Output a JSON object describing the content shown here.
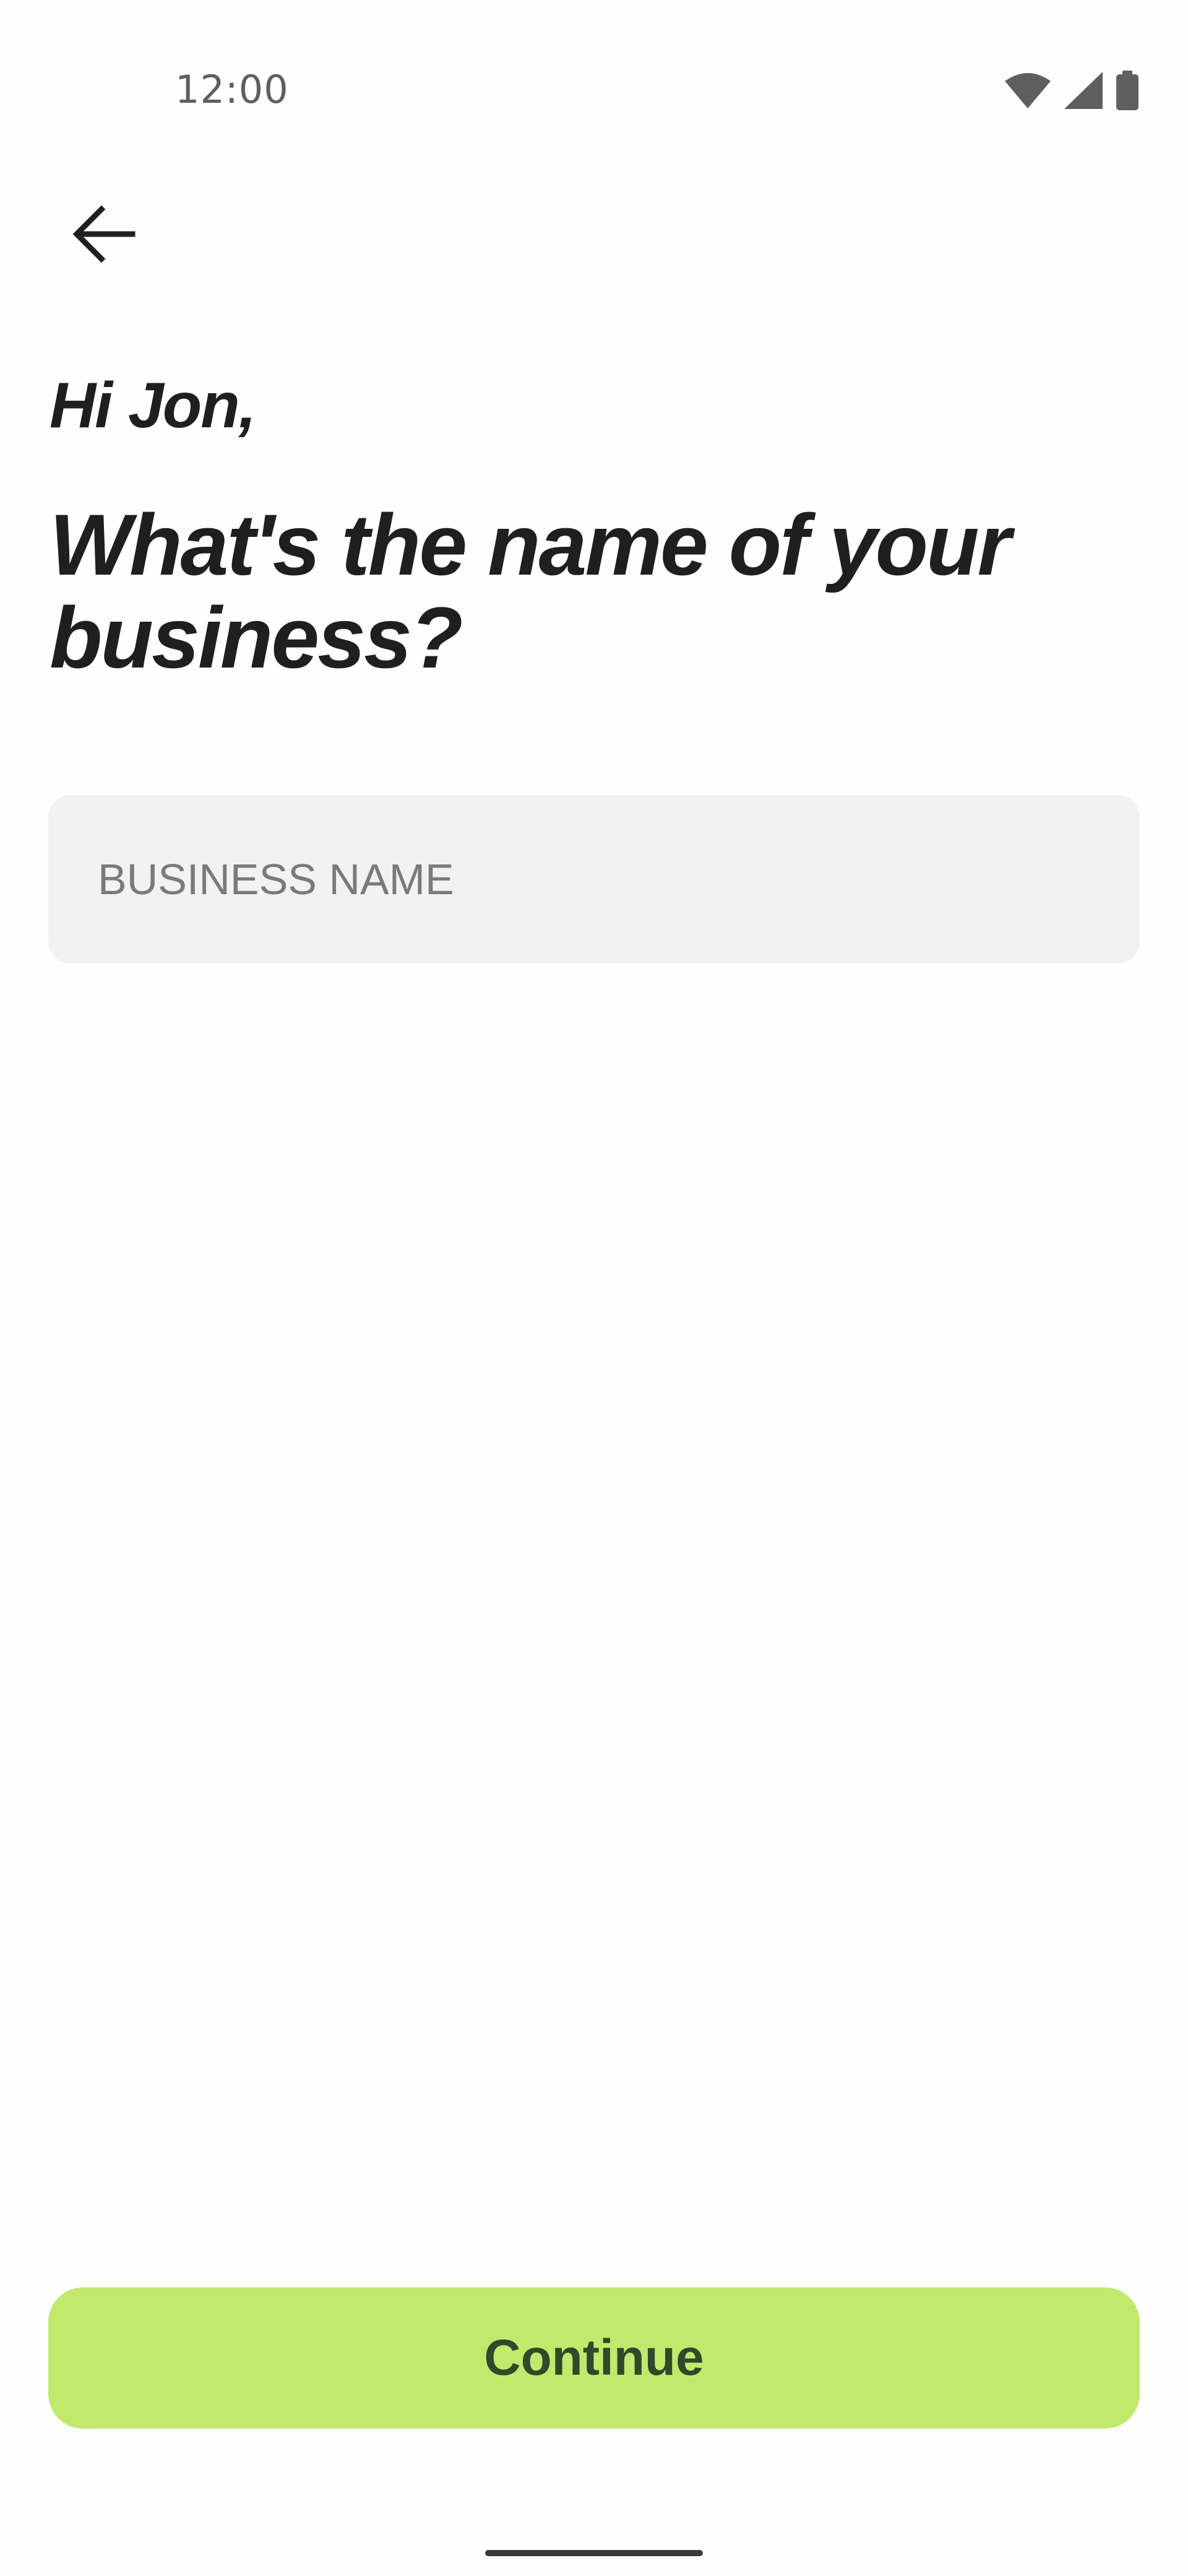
{
  "status_bar": {
    "time": "12:00",
    "icons": [
      "wifi-icon",
      "cellular-signal-icon",
      "battery-icon"
    ]
  },
  "header": {
    "back_icon": "arrow-left-icon"
  },
  "main": {
    "greeting": "Hi Jon,",
    "question": "What's the name of your business?",
    "business_name": {
      "value": "",
      "placeholder": "BUSINESS NAME"
    }
  },
  "footer": {
    "continue_label": "Continue"
  },
  "colors": {
    "accent": "#c1ea6d",
    "accent_text": "#2e4a2a",
    "input_background": "#f2f2f2",
    "text_primary": "#1f1f1f"
  }
}
